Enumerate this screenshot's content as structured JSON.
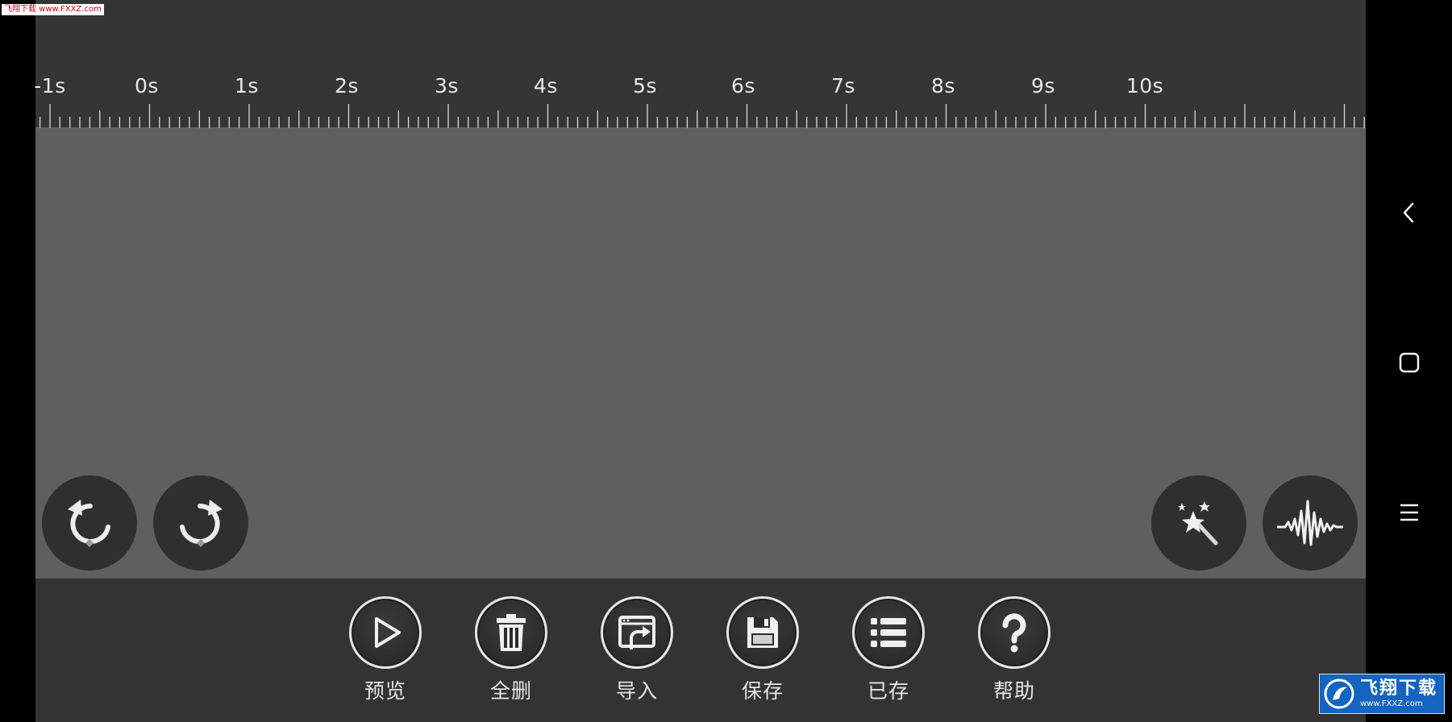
{
  "ruler": {
    "labels": [
      "-1s",
      "0s",
      "1s",
      "2s",
      "3s",
      "4s",
      "5s",
      "6s",
      "7s",
      "8s",
      "9s",
      "10s"
    ]
  },
  "icons": {
    "undo": "undo-icon",
    "redo": "redo-icon",
    "magic": "magic-wand-icon",
    "waveform": "waveform-icon",
    "back": "back-chevron-icon",
    "home": "home-square-icon",
    "recents": "menu-lines-icon"
  },
  "toolbar": {
    "items": [
      {
        "label": "预览",
        "icon": "play-icon"
      },
      {
        "label": "全删",
        "icon": "trash-icon"
      },
      {
        "label": "导入",
        "icon": "import-icon"
      },
      {
        "label": "保存",
        "icon": "floppy-disk-icon"
      },
      {
        "label": "已存",
        "icon": "list-icon"
      },
      {
        "label": "帮助",
        "icon": "help-icon"
      }
    ]
  },
  "watermarks": {
    "top_left": "飞翔下载 www.FXXZ.com",
    "bottom_right_cn": "飞翔下载",
    "bottom_right_url": "www.FXXZ.com"
  },
  "colors": {
    "track": "#5f5f5f",
    "panel": "#333333",
    "button": "#2f2f2f",
    "foreground": "#e6e6e6"
  }
}
